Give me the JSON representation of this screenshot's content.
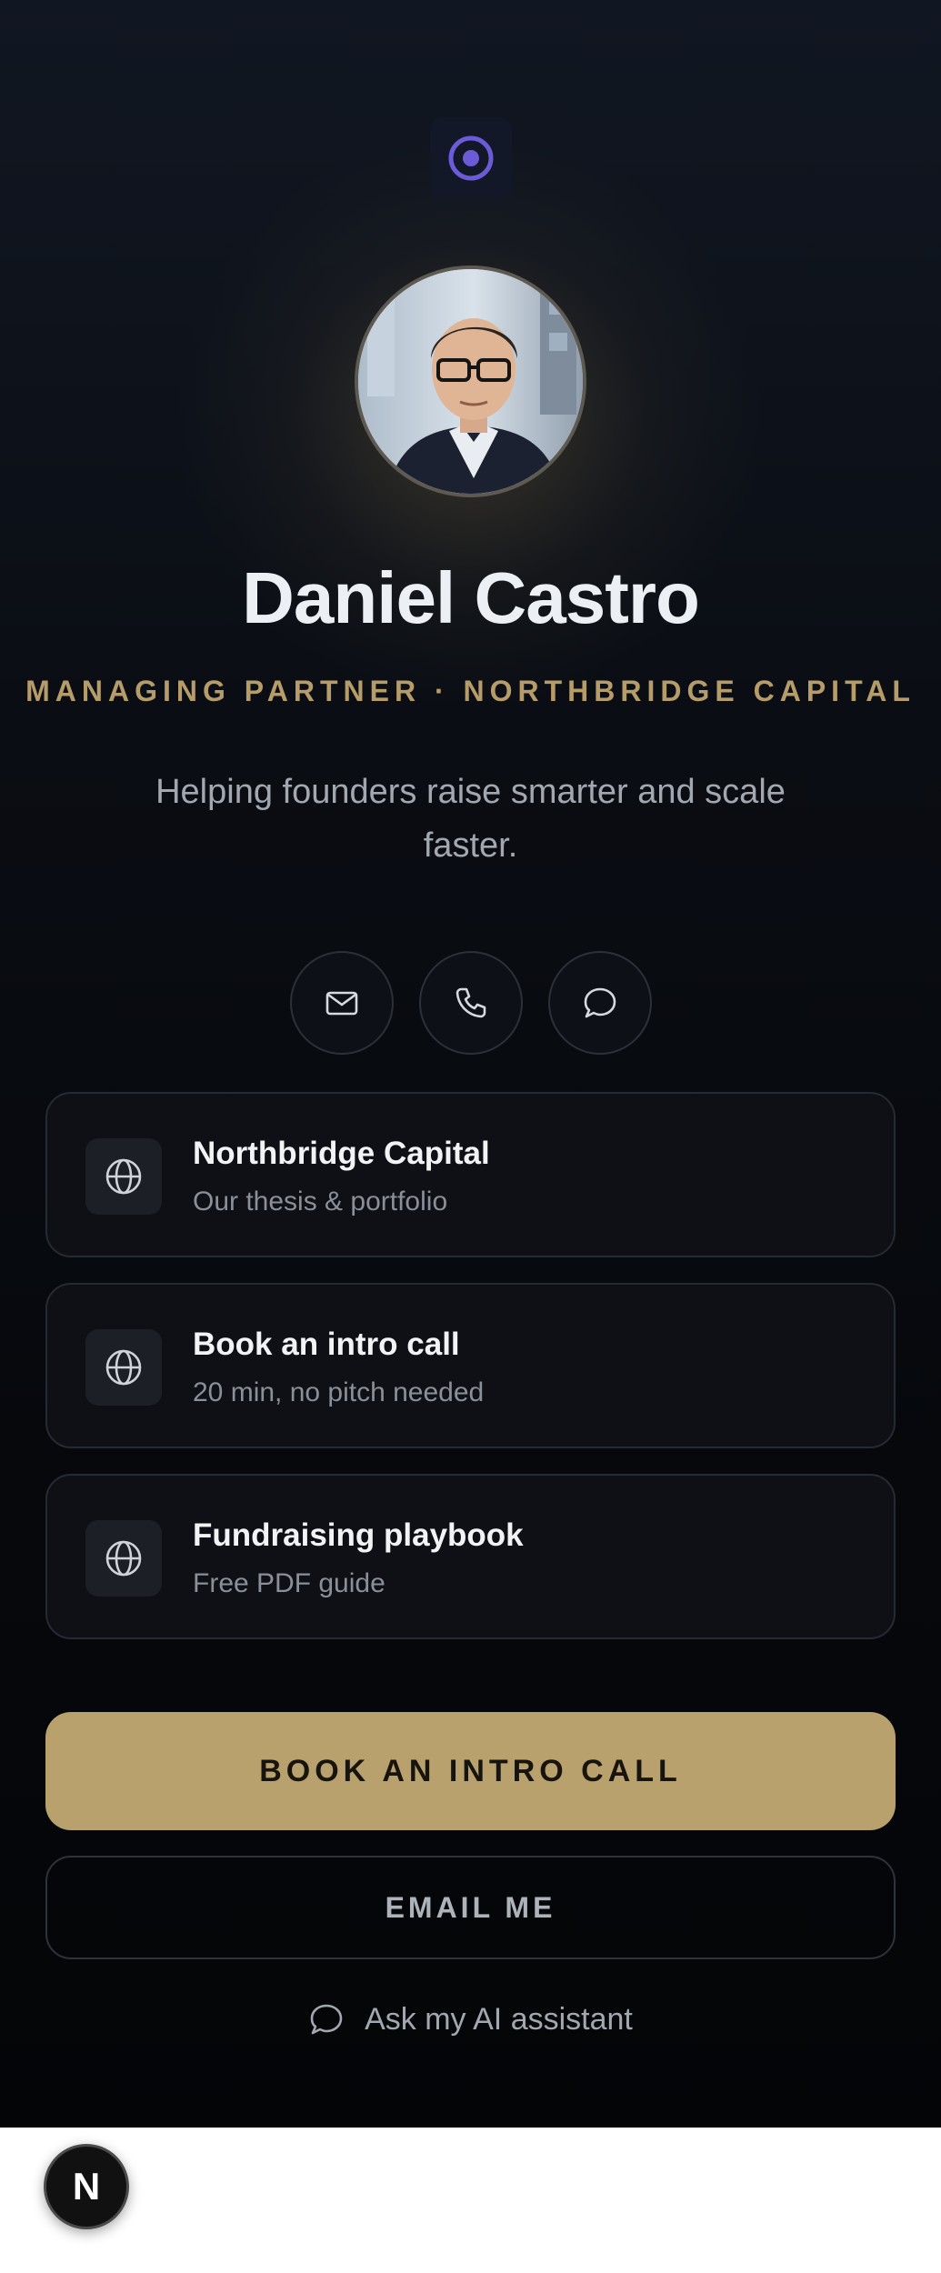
{
  "profile": {
    "name": "Daniel Castro",
    "role": "MANAGING PARTNER · NORTHBRIDGE CAPITAL",
    "tagline": "Helping founders raise smarter and scale faster."
  },
  "contact_buttons": [
    {
      "icon": "mail-icon"
    },
    {
      "icon": "phone-icon"
    },
    {
      "icon": "chat-icon"
    }
  ],
  "links": [
    {
      "title": "Northbridge Capital",
      "subtitle": "Our thesis & portfolio",
      "icon": "globe-icon"
    },
    {
      "title": "Book an intro call",
      "subtitle": "20 min, no pitch needed",
      "icon": "globe-icon"
    },
    {
      "title": "Fundraising playbook",
      "subtitle": "Free PDF guide",
      "icon": "globe-icon"
    }
  ],
  "cta": {
    "primary_label": "BOOK AN INTRO CALL",
    "secondary_label": "EMAIL ME",
    "ai_label": "Ask my AI assistant"
  },
  "badge": {
    "letter": "N"
  },
  "colors": {
    "accent_gold": "#b8a16d",
    "logo_purple": "#6b5bd6",
    "background": "#06080c"
  }
}
